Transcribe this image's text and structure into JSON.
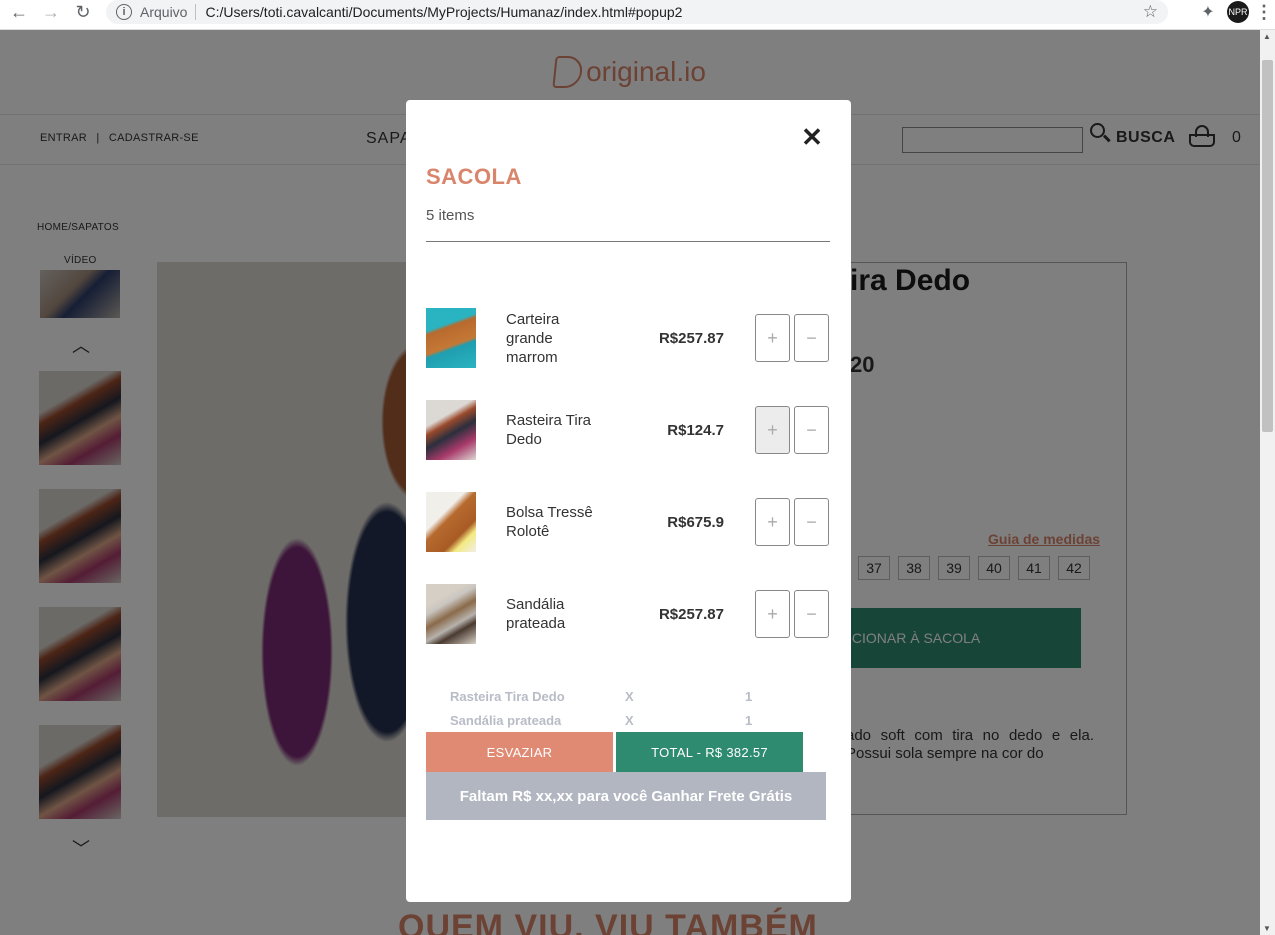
{
  "browser": {
    "scheme_label": "Arquivo",
    "url": "C:/Users/toti.cavalcanti/Documents/MyProjects/Humanaz/index.html#popup2",
    "profile_text": "NPR"
  },
  "header": {
    "logo_text": "original.io",
    "auth": {
      "login": "ENTRAR",
      "separator": "|",
      "register": "CADASTRAR-SE"
    },
    "menu_item": "SAPA",
    "search_label": "BUSCA",
    "cart_count": "0"
  },
  "product_page": {
    "breadcrumb": "HOME/SAPATOS",
    "video_label": "VÍDEO",
    "title_fragment": "ira Dedo",
    "price_fragment": "20",
    "size_guide": "Guia de medidas",
    "sizes": [
      "37",
      "38",
      "39",
      "40",
      "41",
      "42"
    ],
    "add_to_bag_fragment": "ICIONAR À SACOLA",
    "description_fragment": "ado soft com tira no dedo e ela. Possui sola sempre na cor do",
    "related_heading_fragment": "QUEM VIU, VIU TAMBÉM"
  },
  "modal": {
    "close_symbol": "✕",
    "title": "SACOLA",
    "count_label": "5 items",
    "items": [
      {
        "name": "Carteira grande marrom",
        "price": "R$257.87",
        "plus": "+",
        "minus": "−"
      },
      {
        "name": "Rasteira Tira Dedo",
        "price": "R$124.7",
        "plus": "+",
        "minus": "−"
      },
      {
        "name": "Bolsa Tressê Rolotê",
        "price": "R$675.9",
        "plus": "+",
        "minus": "−"
      },
      {
        "name": "Sandália prateada",
        "price": "R$257.87",
        "plus": "+",
        "minus": "−"
      }
    ],
    "summary": [
      {
        "name": "Rasteira Tira Dedo",
        "x": "X",
        "qty": "1"
      },
      {
        "name": "Sandália prateada",
        "x": "X",
        "qty": "1"
      }
    ],
    "empty_button": "ESVAZIAR",
    "total_button": "TOTAL - R$ 382.57",
    "shipping_banner": {
      "prefix": "Faltam R$ xx,xx para você",
      "highlight": "Ganhar Frete Grátis"
    }
  },
  "colors": {
    "accent": "#d9856b",
    "primary_green": "#2e8b6f",
    "muted_gray": "#b1b6c1"
  }
}
